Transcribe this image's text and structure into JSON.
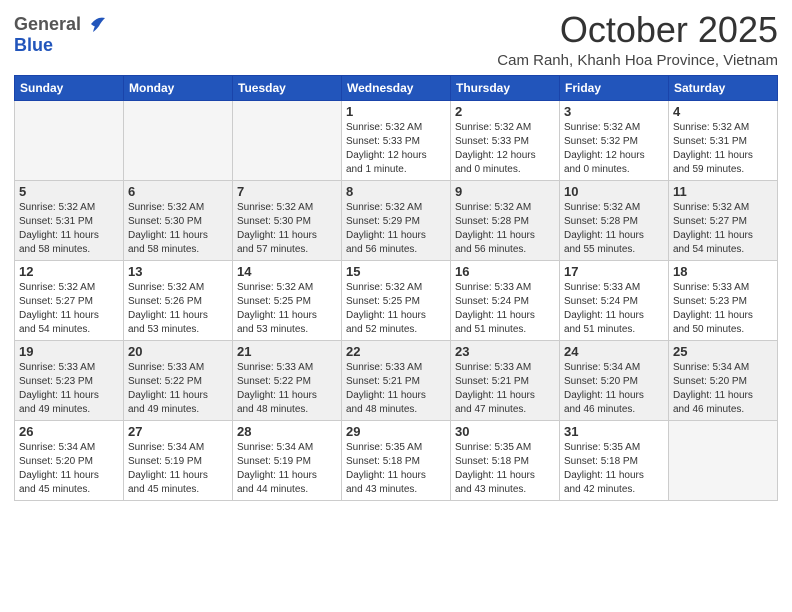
{
  "logo": {
    "general": "General",
    "blue": "Blue"
  },
  "header": {
    "month": "October 2025",
    "location": "Cam Ranh, Khanh Hoa Province, Vietnam"
  },
  "weekdays": [
    "Sunday",
    "Monday",
    "Tuesday",
    "Wednesday",
    "Thursday",
    "Friday",
    "Saturday"
  ],
  "weeks": [
    [
      {
        "day": "",
        "info": ""
      },
      {
        "day": "",
        "info": ""
      },
      {
        "day": "",
        "info": ""
      },
      {
        "day": "1",
        "info": "Sunrise: 5:32 AM\nSunset: 5:33 PM\nDaylight: 12 hours\nand 1 minute."
      },
      {
        "day": "2",
        "info": "Sunrise: 5:32 AM\nSunset: 5:33 PM\nDaylight: 12 hours\nand 0 minutes."
      },
      {
        "day": "3",
        "info": "Sunrise: 5:32 AM\nSunset: 5:32 PM\nDaylight: 12 hours\nand 0 minutes."
      },
      {
        "day": "4",
        "info": "Sunrise: 5:32 AM\nSunset: 5:31 PM\nDaylight: 11 hours\nand 59 minutes."
      }
    ],
    [
      {
        "day": "5",
        "info": "Sunrise: 5:32 AM\nSunset: 5:31 PM\nDaylight: 11 hours\nand 58 minutes."
      },
      {
        "day": "6",
        "info": "Sunrise: 5:32 AM\nSunset: 5:30 PM\nDaylight: 11 hours\nand 58 minutes."
      },
      {
        "day": "7",
        "info": "Sunrise: 5:32 AM\nSunset: 5:30 PM\nDaylight: 11 hours\nand 57 minutes."
      },
      {
        "day": "8",
        "info": "Sunrise: 5:32 AM\nSunset: 5:29 PM\nDaylight: 11 hours\nand 56 minutes."
      },
      {
        "day": "9",
        "info": "Sunrise: 5:32 AM\nSunset: 5:28 PM\nDaylight: 11 hours\nand 56 minutes."
      },
      {
        "day": "10",
        "info": "Sunrise: 5:32 AM\nSunset: 5:28 PM\nDaylight: 11 hours\nand 55 minutes."
      },
      {
        "day": "11",
        "info": "Sunrise: 5:32 AM\nSunset: 5:27 PM\nDaylight: 11 hours\nand 54 minutes."
      }
    ],
    [
      {
        "day": "12",
        "info": "Sunrise: 5:32 AM\nSunset: 5:27 PM\nDaylight: 11 hours\nand 54 minutes."
      },
      {
        "day": "13",
        "info": "Sunrise: 5:32 AM\nSunset: 5:26 PM\nDaylight: 11 hours\nand 53 minutes."
      },
      {
        "day": "14",
        "info": "Sunrise: 5:32 AM\nSunset: 5:25 PM\nDaylight: 11 hours\nand 53 minutes."
      },
      {
        "day": "15",
        "info": "Sunrise: 5:32 AM\nSunset: 5:25 PM\nDaylight: 11 hours\nand 52 minutes."
      },
      {
        "day": "16",
        "info": "Sunrise: 5:33 AM\nSunset: 5:24 PM\nDaylight: 11 hours\nand 51 minutes."
      },
      {
        "day": "17",
        "info": "Sunrise: 5:33 AM\nSunset: 5:24 PM\nDaylight: 11 hours\nand 51 minutes."
      },
      {
        "day": "18",
        "info": "Sunrise: 5:33 AM\nSunset: 5:23 PM\nDaylight: 11 hours\nand 50 minutes."
      }
    ],
    [
      {
        "day": "19",
        "info": "Sunrise: 5:33 AM\nSunset: 5:23 PM\nDaylight: 11 hours\nand 49 minutes."
      },
      {
        "day": "20",
        "info": "Sunrise: 5:33 AM\nSunset: 5:22 PM\nDaylight: 11 hours\nand 49 minutes."
      },
      {
        "day": "21",
        "info": "Sunrise: 5:33 AM\nSunset: 5:22 PM\nDaylight: 11 hours\nand 48 minutes."
      },
      {
        "day": "22",
        "info": "Sunrise: 5:33 AM\nSunset: 5:21 PM\nDaylight: 11 hours\nand 48 minutes."
      },
      {
        "day": "23",
        "info": "Sunrise: 5:33 AM\nSunset: 5:21 PM\nDaylight: 11 hours\nand 47 minutes."
      },
      {
        "day": "24",
        "info": "Sunrise: 5:34 AM\nSunset: 5:20 PM\nDaylight: 11 hours\nand 46 minutes."
      },
      {
        "day": "25",
        "info": "Sunrise: 5:34 AM\nSunset: 5:20 PM\nDaylight: 11 hours\nand 46 minutes."
      }
    ],
    [
      {
        "day": "26",
        "info": "Sunrise: 5:34 AM\nSunset: 5:20 PM\nDaylight: 11 hours\nand 45 minutes."
      },
      {
        "day": "27",
        "info": "Sunrise: 5:34 AM\nSunset: 5:19 PM\nDaylight: 11 hours\nand 45 minutes."
      },
      {
        "day": "28",
        "info": "Sunrise: 5:34 AM\nSunset: 5:19 PM\nDaylight: 11 hours\nand 44 minutes."
      },
      {
        "day": "29",
        "info": "Sunrise: 5:35 AM\nSunset: 5:18 PM\nDaylight: 11 hours\nand 43 minutes."
      },
      {
        "day": "30",
        "info": "Sunrise: 5:35 AM\nSunset: 5:18 PM\nDaylight: 11 hours\nand 43 minutes."
      },
      {
        "day": "31",
        "info": "Sunrise: 5:35 AM\nSunset: 5:18 PM\nDaylight: 11 hours\nand 42 minutes."
      },
      {
        "day": "",
        "info": ""
      }
    ]
  ]
}
